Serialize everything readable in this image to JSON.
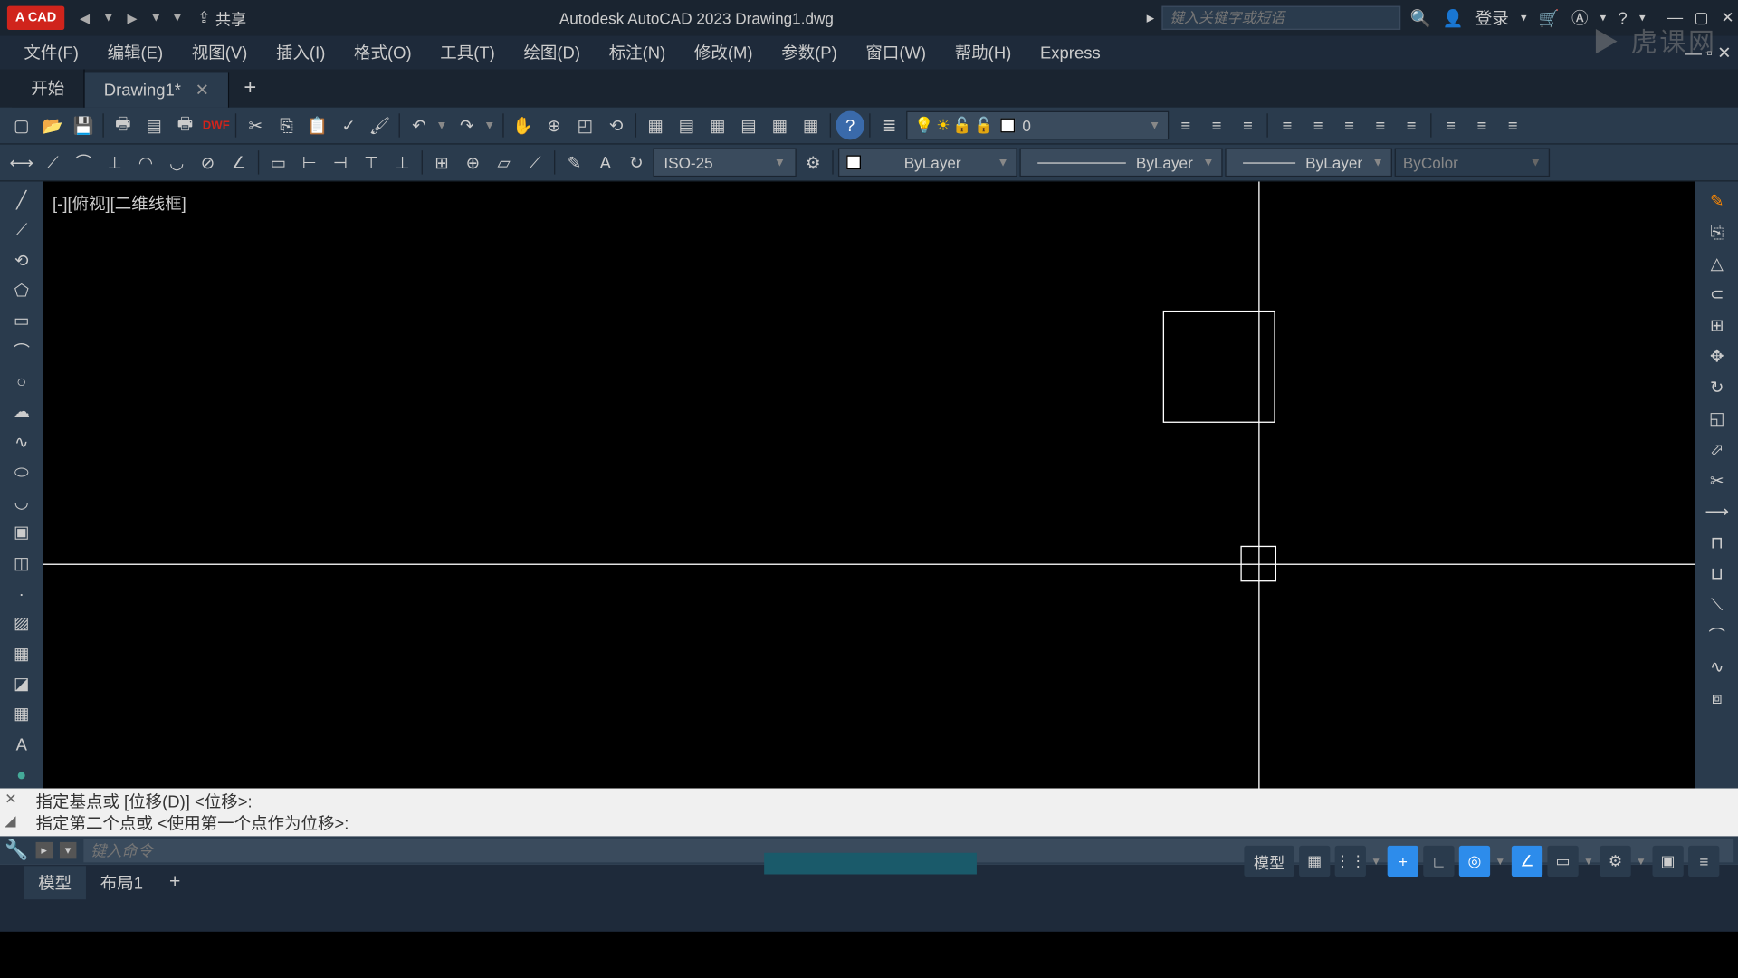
{
  "titlebar": {
    "app_badge": "A CAD",
    "share": "共享",
    "title": "Autodesk AutoCAD 2023   Drawing1.dwg",
    "search_placeholder": "键入关键字或短语",
    "login": "登录"
  },
  "menu": {
    "items": [
      "文件(F)",
      "编辑(E)",
      "视图(V)",
      "插入(I)",
      "格式(O)",
      "工具(T)",
      "绘图(D)",
      "标注(N)",
      "修改(M)",
      "参数(P)",
      "窗口(W)",
      "帮助(H)",
      "Express"
    ]
  },
  "tabs": {
    "start": "开始",
    "drawing": "Drawing1*"
  },
  "layer": {
    "current": "0"
  },
  "props": {
    "color": "ByLayer",
    "linetype": "ByLayer",
    "lineweight": "ByLayer",
    "plot": "ByColor"
  },
  "dimstyle": "ISO-25",
  "viewport": {
    "label": "[-][俯视][二维线框]"
  },
  "command": {
    "line1": "指定基点或 [位移(D)] <位移>:",
    "line2": "指定第二个点或 <使用第一个点作为位移>:",
    "placeholder": "键入命令"
  },
  "layout": {
    "model": "模型",
    "layout1": "布局1"
  },
  "status": {
    "model": "模型"
  },
  "watermark": "虎课网"
}
